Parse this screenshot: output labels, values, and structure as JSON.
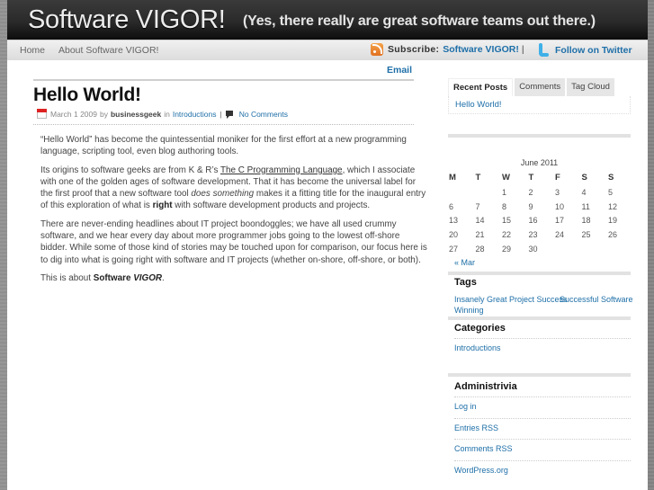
{
  "header": {
    "site_title": "Software VIGOR!",
    "tagline": "(Yes, there really are great software teams out there.)"
  },
  "nav": {
    "items": [
      {
        "label": "Home"
      },
      {
        "label": "About Software VIGOR!"
      }
    ],
    "subscribe_label": "Subscribe:",
    "subscribe_link": "Software VIGOR!",
    "subscribe_sep": "|",
    "twitter_label": "Follow on Twitter",
    "email_label": "Email"
  },
  "post": {
    "title": "Hello World!",
    "date": "March 1 2009",
    "by": "by",
    "author": "businessgeek",
    "in": "in",
    "category": "Introductions",
    "sep": "|",
    "comments": "No Comments",
    "paragraphs": {
      "p1": "“Hello World” has become the quintessential moniker for the first effort at a new programming language, scripting tool, even blog authoring tools.",
      "p2_a": "Its origins to software geeks are from K & R’s ",
      "p2_link": "The C Programming Language",
      "p2_b": ", which I associate with one of the golden ages of software development. That it has become the universal label for the first proof that a new software tool ",
      "p2_em": "does something",
      "p2_c": " makes it a fitting title for the inaugural entry of this exploration of what is ",
      "p2_strong": "right",
      "p2_d": " with software development products and projects.",
      "p3": "There are never-ending headlines about IT project boondoggles; we have all used crummy software, and we hear every day about more programmer jobs going to the lowest off-shore bidder. While some of those kind of stories may be touched upon for comparison, our focus here is to dig into what is going right with software and IT projects (whether on-shore, off-shore, or both).",
      "p4_a": "This is about ",
      "p4_strong": "Software",
      "p4_em": "VIGOR",
      "p4_end": "."
    }
  },
  "sidebar": {
    "tabs": [
      {
        "label": "Recent Posts",
        "active": true
      },
      {
        "label": "Comments",
        "active": false
      },
      {
        "label": "Tag Cloud",
        "active": false
      }
    ],
    "recent_posts": [
      "Hello World!"
    ],
    "calendar": {
      "caption": "June 2011",
      "weekdays": [
        "M",
        "T",
        "W",
        "T",
        "F",
        "S",
        "S"
      ],
      "weeks": [
        [
          "",
          "",
          "1",
          "2",
          "3",
          "4",
          "5"
        ],
        [
          "6",
          "7",
          "8",
          "9",
          "10",
          "11",
          "12"
        ],
        [
          "13",
          "14",
          "15",
          "16",
          "17",
          "18",
          "19"
        ],
        [
          "20",
          "21",
          "22",
          "23",
          "24",
          "25",
          "26"
        ],
        [
          "27",
          "28",
          "29",
          "30",
          "",
          "",
          ""
        ]
      ],
      "prev_label": "« Mar"
    },
    "tags_title": "Tags",
    "tags": [
      "Insanely Great Project Success",
      "Successful Software",
      "Winning"
    ],
    "categories_title": "Categories",
    "categories": [
      "Introductions"
    ],
    "admin_title": "Administrivia",
    "admin_links": [
      "Log in",
      "Entries RSS",
      "Comments RSS",
      "WordPress.org"
    ]
  }
}
